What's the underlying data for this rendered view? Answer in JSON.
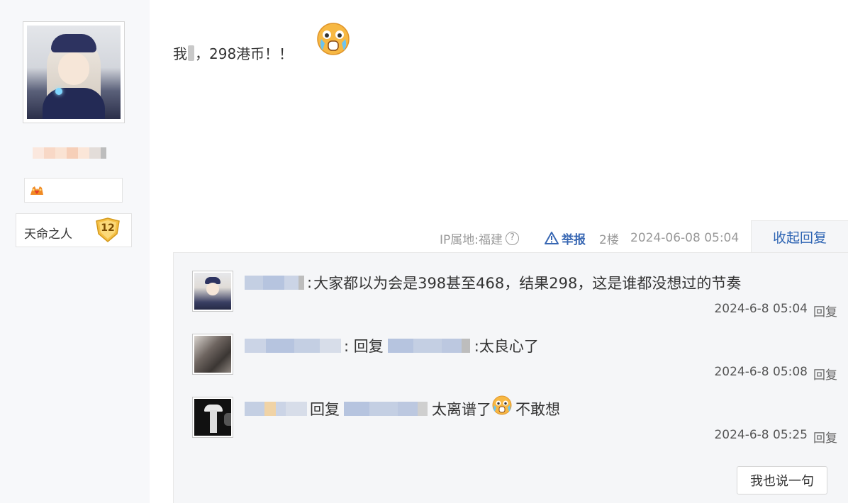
{
  "author": {
    "avatar_icon": "anime-girl-avatar",
    "level_title": "天命之人",
    "level_number": "12"
  },
  "post": {
    "text_before": "我",
    "text_after": "，298港币！！",
    "emoji": "crying-shocked-emoji"
  },
  "meta": {
    "ip_label": "IP属地:福建",
    "help_icon": "?",
    "report_label": "举报",
    "floor": "2楼",
    "time": "2024-06-08 05:04",
    "collapse_label": "收起回复"
  },
  "replies": [
    {
      "prefix": ": ",
      "text": "大家都以为会是398甚至468，结果298，这是谁都没想过的节奏",
      "time": "2024-6-8 05:04",
      "reply_label": "回复"
    },
    {
      "prefix": ": 回复 ",
      "text": ":太良心了",
      "time": "2024-6-8 05:08",
      "reply_label": "回复"
    },
    {
      "prefix": "回复 ",
      "text": "太离谱了",
      "text_after": " 不敢想",
      "time": "2024-6-8 05:25",
      "reply_label": "回复"
    }
  ],
  "say_button_label": "我也说一句",
  "colors": {
    "link_blue": "#3867b3",
    "panel_bg": "#f5f6f8",
    "sidebar_bg": "#f7f8fa"
  }
}
